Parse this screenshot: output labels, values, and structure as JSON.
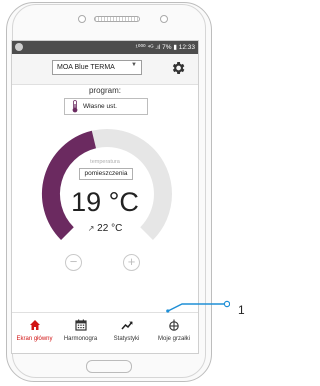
{
  "status_bar": {
    "right_text": "¹⁰⁰⁰ ⁴ᴳ .ıl 7% ▮ 12:33",
    "left_icon": "settings-dot-icon"
  },
  "header": {
    "device_select": "MOA Blue TERMA",
    "settings_icon": "gear-icon"
  },
  "program": {
    "label": "program:",
    "value": "Własne ust.",
    "icon": "thermometer-icon"
  },
  "temperature": {
    "caption": "temperatura",
    "mode": "pomieszczenia",
    "value": "19 °C",
    "room_value": "22 °C",
    "room_icon": "arrow-up-right-icon",
    "dial_fill_fraction": 0.45,
    "accent_color": "#6b2a60",
    "track_color": "#e6e6e6"
  },
  "controls": {
    "decrease": "−",
    "increase": "+"
  },
  "bottom_nav": {
    "items": [
      {
        "label": "Ekran główny",
        "icon": "home-icon",
        "active": true
      },
      {
        "label": "Harmonogra",
        "icon": "calendar-icon",
        "active": false
      },
      {
        "label": "Statystyki",
        "icon": "trend-icon",
        "active": false
      },
      {
        "label": "Moje grzałki",
        "icon": "heater-icon",
        "active": false
      }
    ]
  },
  "callout": {
    "label": "1"
  }
}
